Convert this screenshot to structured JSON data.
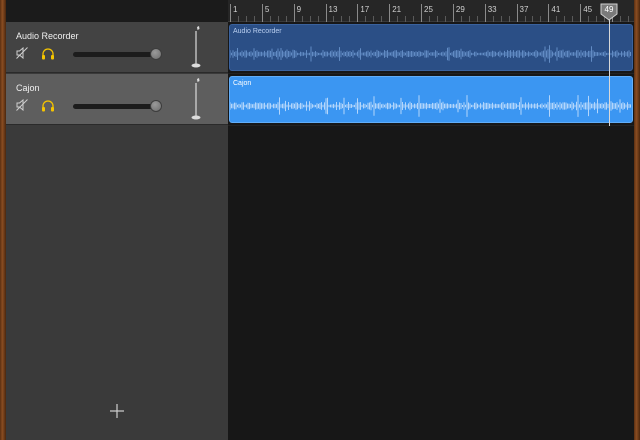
{
  "tracks": [
    {
      "name": "Audio Recorder",
      "volume": 0.97,
      "muted": false,
      "solo": false
    },
    {
      "name": "Cajon",
      "volume": 0.97,
      "muted": false,
      "solo": false
    }
  ],
  "ruler": {
    "labels": [
      "1",
      "5",
      "9",
      "13",
      "17",
      "21",
      "25",
      "29",
      "33",
      "37",
      "41",
      "45",
      "49"
    ],
    "first_bar": 1,
    "last_visible_bar": 51
  },
  "regions": [
    {
      "name": "Audio Recorder",
      "color": "#2b4f86",
      "wave_color": "#7aa6e0"
    },
    {
      "name": "Cajon",
      "color": "#3b96f2",
      "wave_color": "#e8f3ff"
    }
  ],
  "playhead": {
    "bar": 49,
    "label": "49"
  },
  "colors": {
    "solo_accent": "#f5c400",
    "wood": "#7a4420"
  },
  "icons": {
    "mute": "speaker-mute-icon",
    "solo": "headphones-icon",
    "mic": "microphone-stand-icon",
    "add": "plus-icon"
  }
}
